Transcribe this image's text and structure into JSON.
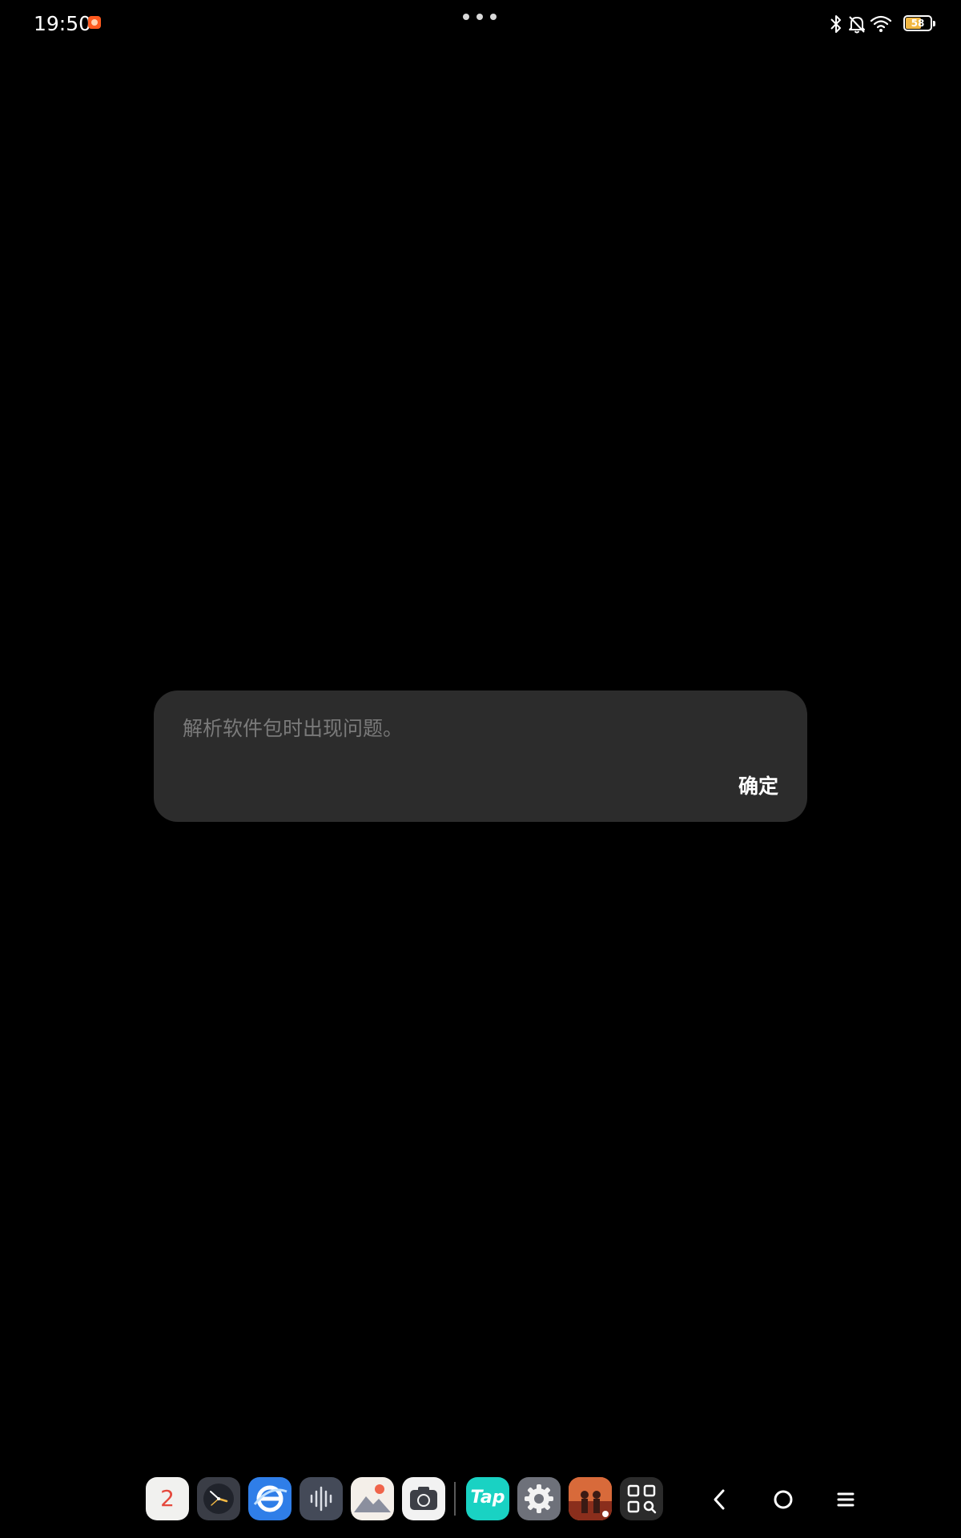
{
  "status_bar": {
    "time": "19:50",
    "battery_level": "58",
    "icons": [
      "app-notification-icon",
      "bluetooth-icon",
      "bell-muted-icon",
      "wifi-icon",
      "battery-icon"
    ]
  },
  "window": {
    "menu_icon": "more-dots-icon"
  },
  "dialog": {
    "message": "解析软件包时出现问题。",
    "ok_label": "确定"
  },
  "dock": {
    "calendar_day": "2",
    "tap_label": "Tap",
    "apps": [
      "calendar-icon",
      "clock-icon",
      "browser-icon",
      "recorder-icon",
      "gallery-icon",
      "camera-icon",
      "taptap-icon",
      "settings-icon",
      "game-icon",
      "app-drawer-icon"
    ],
    "nav": [
      "back-icon",
      "home-icon",
      "recents-icon"
    ]
  },
  "colors": {
    "background": "#000000",
    "dialog_background": "#2c2c2c",
    "message_text": "#7a7a7a",
    "button_text": "#ffffff",
    "battery_fill": "#f2b843",
    "taptap_brand": "#19d2c3"
  }
}
